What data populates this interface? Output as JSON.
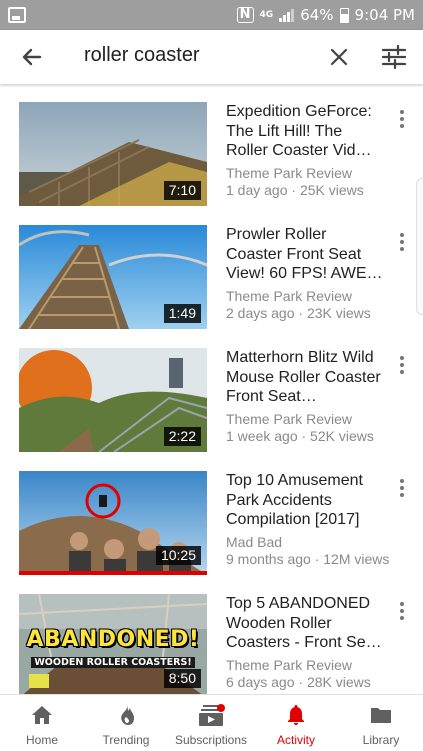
{
  "status_bar": {
    "battery": "64%",
    "time": "9:04 PM",
    "icons": [
      "image-icon",
      "nfc-icon",
      "hd-signal-icon",
      "signal-icon",
      "battery-icon"
    ]
  },
  "search": {
    "query": "roller coaster",
    "icons": [
      "back-arrow-icon",
      "clear-icon",
      "filter-icon"
    ]
  },
  "results": [
    {
      "title": "Expedition GeForce: The Lift Hill! The Roller Coaster Vid…",
      "channel": "Theme Park Review",
      "meta": "1 day ago · 25K views",
      "duration": "7:10"
    },
    {
      "title": "Prowler Roller Coaster Front Seat View! 60 FPS! AWE…",
      "channel": "Theme Park Review",
      "meta": "2 days ago · 23K views",
      "duration": "1:49"
    },
    {
      "title": "Matterhorn Blitz Wild Mouse Roller Coaster Front Seat…",
      "channel": "Theme Park Review",
      "meta": "1 week ago · 52K views",
      "duration": "2:22"
    },
    {
      "title": "Top 10 Amusement Park Accidents Compilation [2017]",
      "channel": "Mad Bad",
      "meta": "9 months ago · 12M views",
      "duration": "10:25",
      "watched": true
    },
    {
      "title": "Top 5 ABANDONED Wooden Roller Coasters - Front Se…",
      "channel": "Theme Park Review",
      "meta": "6 days ago · 28K views",
      "duration": "8:50",
      "watched": true,
      "thumb_text": [
        "ABANDONED!",
        "WOODEN ROLLER COASTERS!"
      ]
    }
  ],
  "bottom_nav": {
    "items": [
      {
        "label": "Home",
        "icon": "home-icon"
      },
      {
        "label": "Trending",
        "icon": "trending-flame-icon"
      },
      {
        "label": "Subscriptions",
        "icon": "subscriptions-icon"
      },
      {
        "label": "Activity",
        "icon": "bell-icon",
        "active": true
      },
      {
        "label": "Library",
        "icon": "folder-icon"
      }
    ]
  },
  "colors": {
    "accent_red": "#e00000",
    "status_bar": "#9e9e9e",
    "secondary_text": "#8a8a8a"
  }
}
